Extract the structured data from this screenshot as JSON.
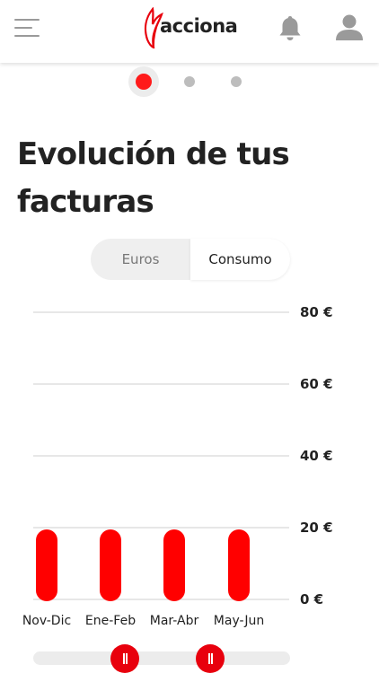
{
  "header": {
    "brand": "acciona",
    "menu_icon": "hamburger-menu-icon",
    "notifications_icon": "bell-icon",
    "profile_icon": "user-icon",
    "brand_color": "#e8000d"
  },
  "pager": {
    "pages": 3,
    "active_index": 0
  },
  "title": "Evolución de tus facturas",
  "toggle": {
    "options": [
      "Euros",
      "Consumo"
    ],
    "selected": "Consumo"
  },
  "chart_data": {
    "type": "bar",
    "categories": [
      "Nov-Dic",
      "Ene-Feb",
      "Mar-Abr",
      "May-Jun"
    ],
    "values": [
      20,
      20,
      20,
      20
    ],
    "ylim": [
      0,
      80
    ],
    "yticks": [
      {
        "value": 0,
        "label": "0 €"
      },
      {
        "value": 20,
        "label": "20 €"
      },
      {
        "value": 40,
        "label": "40 €"
      },
      {
        "value": 60,
        "label": "60 €"
      },
      {
        "value": 80,
        "label": "80 €"
      }
    ],
    "bar_color": "#ff0000",
    "grid": true,
    "y_axis_position": "right"
  },
  "range_slider": {
    "min_fraction": 0.35,
    "max_fraction": 0.69
  }
}
